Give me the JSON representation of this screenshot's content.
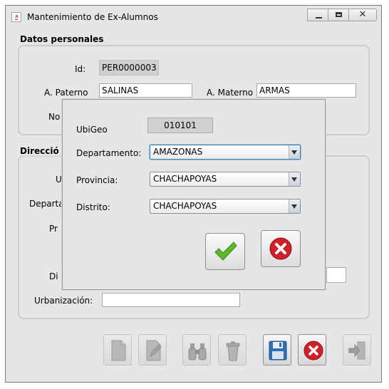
{
  "window": {
    "title": "Mantenimiento de Ex-Alumnos"
  },
  "datos_personales": {
    "title": "Datos personales",
    "id_label": "Id:",
    "id_value": "PER0000003",
    "apaterno_label": "A. Paterno",
    "apaterno_value": "SALINAS",
    "amaterno_label": "A. Materno",
    "amaterno_value": "ARMAS",
    "nombre_label_partial": "No"
  },
  "direccion": {
    "title_partial": "Direcció",
    "ubigeo_label_partial": "U",
    "departamento_label_partial": "Departa",
    "provincia_label_partial": "Pr",
    "distrito_label_partial": "Di",
    "urbanizacion_label": "Urbanización:",
    "urbanizacion_value": ""
  },
  "dialog": {
    "ubigeo_label": "UbiGeo",
    "ubigeo_value": "010101",
    "departamento_label": "Departamento:",
    "departamento_value": "AMAZONAS",
    "provincia_label": "Provincia:",
    "provincia_value": "CHACHAPOYAS",
    "distrito_label": "Distrito:",
    "distrito_value": "CHACHAPOYAS",
    "accept_icon": "check-icon",
    "cancel_icon": "cancel-icon"
  },
  "toolbar": {
    "buttons": [
      "new-document-icon",
      "edit-icon",
      "search-binoculars-icon",
      "delete-trash-icon",
      "save-floppy-icon",
      "cancel-icon",
      "exit-icon"
    ]
  },
  "colors": {
    "window_bg": "#e6e6e6",
    "accent_check": "#5cb82a",
    "accent_cancel": "#d0202a",
    "save_blue": "#2f6fb5"
  }
}
